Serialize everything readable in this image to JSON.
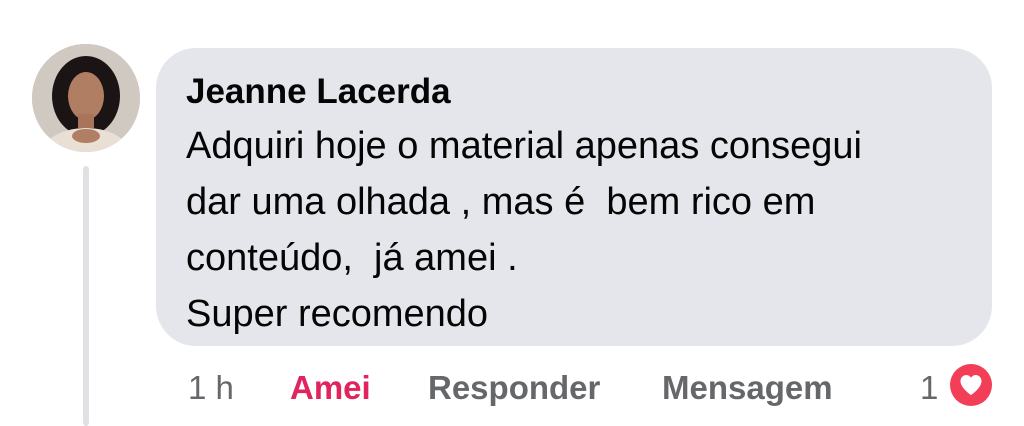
{
  "comment": {
    "author": "Jeanne Lacerda",
    "text_lines": [
      "Adquiri hoje o material apenas consegui",
      "dar uma olhada , mas é  bem rico em",
      "conteúdo,  já amei .",
      "Super recomendo"
    ]
  },
  "actions": {
    "time": "1 h",
    "reaction_label": "Amei",
    "reply_label": "Responder",
    "message_label": "Mensagem"
  },
  "reactions": {
    "count": "1",
    "icon": "heart-icon",
    "color": "#f33e58"
  },
  "colors": {
    "bubble": "#e4e6eb",
    "reacted": "#e0245e",
    "muted": "#65676b"
  }
}
